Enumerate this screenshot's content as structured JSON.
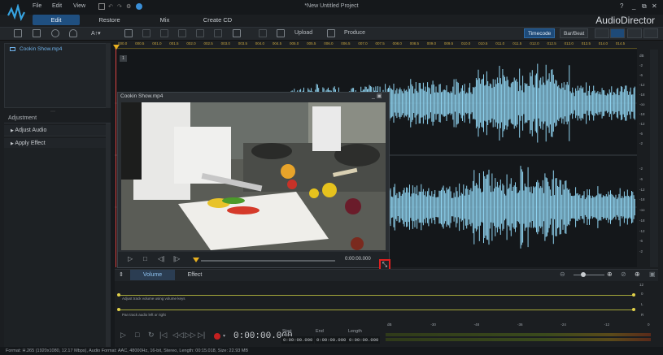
{
  "window": {
    "title": "*New Untitled Project",
    "brand": "AudioDirector",
    "controls": [
      "?",
      "_",
      "⧉",
      "✕"
    ]
  },
  "menu": {
    "file": "File",
    "edit": "Edit",
    "view": "View"
  },
  "modes": {
    "edit": "Edit",
    "restore": "Restore",
    "mix": "Mix",
    "create_cd": "Create CD"
  },
  "toolbar": {
    "text_tool": "A↑▾",
    "upload": "Upload",
    "produce": "Produce",
    "timecode": "Timecode",
    "bar_beat": "Bar/Beat"
  },
  "library": {
    "media_item": "Cookin Show.mp4"
  },
  "adjustment": {
    "header": "Adjustment",
    "items": [
      {
        "label": "Adjust Audio"
      },
      {
        "label": "Apply Effect"
      }
    ]
  },
  "ruler": {
    "ticks": [
      "000.0",
      "000.5",
      "001.0",
      "001.5",
      "002.0",
      "002.5",
      "003.0",
      "003.5",
      "004.0",
      "004.5",
      "005.0",
      "005.5",
      "006.0",
      "006.5",
      "007.0",
      "007.5",
      "008.0",
      "008.5",
      "009.0",
      "009.5",
      "010.0",
      "010.5",
      "011.0",
      "011.5",
      "012.0",
      "012.5",
      "013.0",
      "013.5",
      "014.0",
      "014.5"
    ]
  },
  "track": {
    "label": "1"
  },
  "db_scale": {
    "upper": [
      "dB",
      "-2",
      "-6",
      "-12",
      "-18",
      "-oo",
      "-18",
      "-12",
      "-6",
      "-2"
    ],
    "lower": [
      "-2",
      "-6",
      "-12",
      "-18",
      "-oo",
      "-18",
      "-12",
      "-6",
      "-2"
    ]
  },
  "preview": {
    "title": "Cookin Show.mp4",
    "time": "0:00:00.000",
    "controls": [
      "▷",
      "□",
      "◁|",
      "|▷"
    ],
    "window_controls": "_ ▣"
  },
  "lower_tabs": {
    "volume": "Volume",
    "effect": "Effect"
  },
  "lanes": {
    "volume_hint": "Adjust track volume using volume keys",
    "pan_hint": "Pan track audio left or right",
    "side_labels": [
      "12",
      "0",
      "L",
      "R"
    ]
  },
  "transport": {
    "time": "0:00:00.000",
    "start_label": "Start",
    "end_label": "End",
    "length_label": "Length",
    "start": "0:00:00.000",
    "end": "0:00:00.000",
    "length": "0:00:00.000"
  },
  "meter": {
    "ticks": [
      "dB",
      "-30",
      "-48",
      "-36",
      "-24",
      "-12",
      "0"
    ]
  },
  "status": {
    "text": "Format: H.265 (1920x1080, 12.17 Mbps), Audio Format: AAC, 48000Hz, 16-bit, Stereo, Length: 00:15.018, Size: 22.93 MB"
  },
  "colors": {
    "accent": "#1f4f80",
    "waveform": "#8fd3f0",
    "playhead": "#e8b020",
    "highlight": "#e02020"
  }
}
